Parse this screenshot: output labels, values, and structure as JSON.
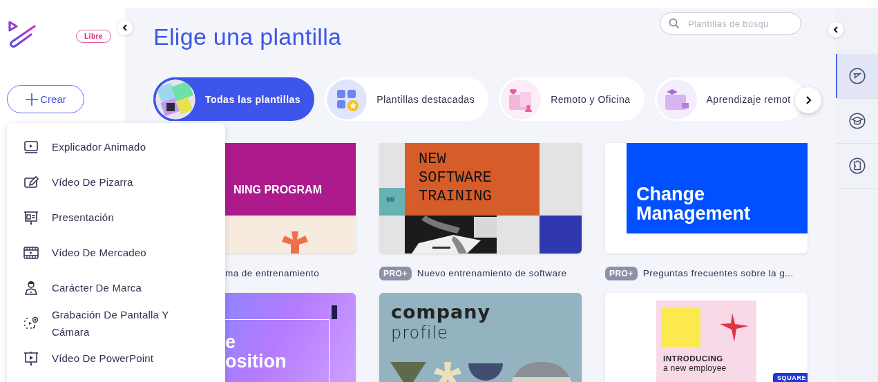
{
  "sidebar": {
    "badge": "Libre",
    "create_button": "Crear"
  },
  "create_menu": {
    "items": [
      {
        "label": "Explicador Animado"
      },
      {
        "label": "Vídeo De Pizarra"
      },
      {
        "label": "Presentación"
      },
      {
        "label": "Vídeo De Mercadeo"
      },
      {
        "label": "Carácter De Marca"
      },
      {
        "label": "Grabación De Pantalla Y Cámara"
      },
      {
        "label": "Vídeo De PowerPoint"
      }
    ]
  },
  "header": {
    "title": "Elige una plantilla",
    "search": {
      "placeholder": "Plantillas de búsqu"
    }
  },
  "categories": [
    {
      "label": "Todas las plantillas",
      "selected": true
    },
    {
      "label": "Plantillas destacadas",
      "selected": false
    },
    {
      "label": "Remoto y Oficina",
      "selected": false
    },
    {
      "label": "Aprendizaje remot",
      "selected": false
    }
  ],
  "templates": [
    {
      "kind": "training",
      "thumb_text": [
        "NING PROGRAM"
      ],
      "caption": "ma de entrenamiento"
    },
    {
      "kind": "software",
      "thumb_text": [
        "NEW",
        "SOFTWARE",
        "TRAINING"
      ],
      "thumb_code": "00",
      "badge": "PRO+",
      "caption": "Nuevo entrenamiento de software"
    },
    {
      "kind": "change",
      "thumb_text": [
        "Change",
        "Management"
      ],
      "badge": "PRO+",
      "caption": "Preguntas frecuentes sobre la g..."
    },
    {
      "kind": "proposition",
      "thumb_text": [
        "e",
        "osition"
      ]
    },
    {
      "kind": "company",
      "thumb_text": [
        "company",
        "profile"
      ]
    },
    {
      "kind": "introducing",
      "thumb_text": [
        "INTRODUCING",
        "a new employee"
      ],
      "tag": "SQUARE"
    }
  ],
  "rail": [
    {
      "selected": true
    },
    {
      "selected": false
    },
    {
      "selected": false
    }
  ]
}
